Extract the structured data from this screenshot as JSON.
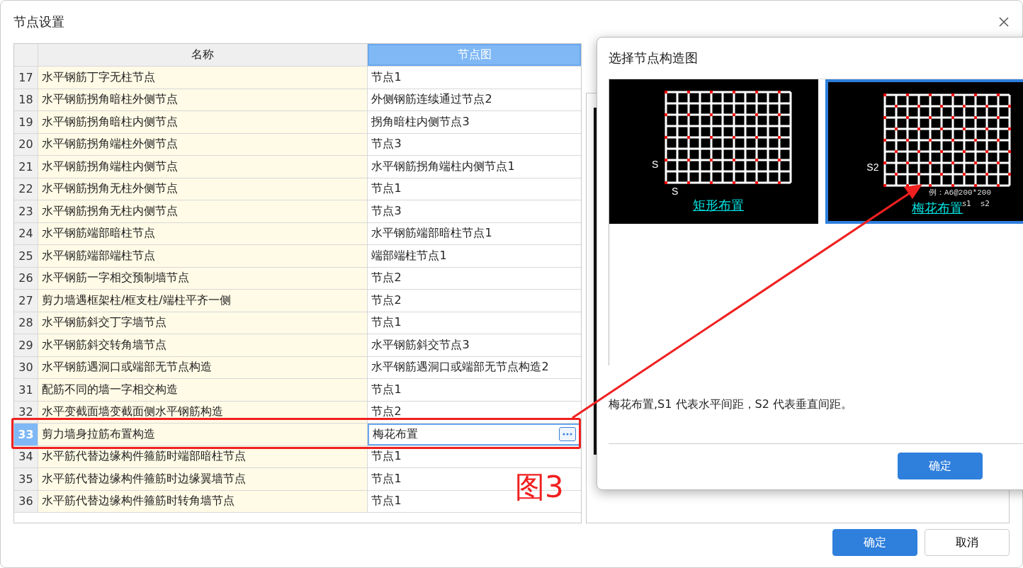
{
  "window": {
    "title": "节点设置"
  },
  "table": {
    "columns": [
      {
        "label": "名称",
        "selected": false
      },
      {
        "label": "节点图",
        "selected": true
      }
    ],
    "rows": [
      {
        "no": "17",
        "name": "水平钢筋丁字无柱节点",
        "value": "节点1",
        "selected": false
      },
      {
        "no": "18",
        "name": "水平钢筋拐角暗柱外侧节点",
        "value": "外侧钢筋连续通过节点2",
        "selected": false
      },
      {
        "no": "19",
        "name": "水平钢筋拐角暗柱内侧节点",
        "value": "拐角暗柱内侧节点3",
        "selected": false
      },
      {
        "no": "20",
        "name": "水平钢筋拐角端柱外侧节点",
        "value": "节点3",
        "selected": false
      },
      {
        "no": "21",
        "name": "水平钢筋拐角端柱内侧节点",
        "value": "水平钢筋拐角端柱内侧节点1",
        "selected": false
      },
      {
        "no": "22",
        "name": "水平钢筋拐角无柱外侧节点",
        "value": "节点1",
        "selected": false
      },
      {
        "no": "23",
        "name": "水平钢筋拐角无柱内侧节点",
        "value": "节点3",
        "selected": false
      },
      {
        "no": "24",
        "name": "水平钢筋端部暗柱节点",
        "value": "水平钢筋端部暗柱节点1",
        "selected": false
      },
      {
        "no": "25",
        "name": "水平钢筋端部端柱节点",
        "value": "端部端柱节点1",
        "selected": false
      },
      {
        "no": "26",
        "name": "水平钢筋一字相交预制墙节点",
        "value": "节点2",
        "selected": false
      },
      {
        "no": "27",
        "name": "剪力墙遇框架柱/框支柱/端柱平齐一侧",
        "value": "节点2",
        "selected": false
      },
      {
        "no": "28",
        "name": "水平钢筋斜交丁字墙节点",
        "value": "节点1",
        "selected": false
      },
      {
        "no": "29",
        "name": "水平钢筋斜交转角墙节点",
        "value": "水平钢筋斜交节点3",
        "selected": false
      },
      {
        "no": "30",
        "name": "水平钢筋遇洞口或端部无节点构造",
        "value": "水平钢筋遇洞口或端部无节点构造2",
        "selected": false
      },
      {
        "no": "31",
        "name": "配筋不同的墙一字相交构造",
        "value": "节点1",
        "selected": false
      },
      {
        "no": "32",
        "name": "水平变截面墙变截面侧水平钢筋构造",
        "value": "节点2",
        "selected": false
      },
      {
        "no": "33",
        "name": "剪力墙身拉筋布置构造",
        "value": "梅花布置",
        "selected": true
      },
      {
        "no": "34",
        "name": "水平筋代替边缘构件箍筋时端部暗柱节点",
        "value": "节点1",
        "selected": false
      },
      {
        "no": "35",
        "name": "水平筋代替边缘构件箍筋时边缘翼墙节点",
        "value": "节点1",
        "selected": false
      },
      {
        "no": "36",
        "name": "水平筋代替边缘构件箍筋时转角墙节点",
        "value": "节点1",
        "selected": false
      }
    ]
  },
  "annotation": {
    "label": "图3"
  },
  "buttons": [
    "确定",
    "取消"
  ],
  "popup": {
    "title": "选择节点构造图",
    "options": [
      {
        "kind": "rect",
        "caption": "矩形布置",
        "selected": false,
        "v_label": "S",
        "h_label": "S"
      },
      {
        "kind": "plum",
        "caption": "梅花布置",
        "selected": true,
        "v_label": "S2",
        "example": "例：A6@200*200",
        "s1": "s1",
        "s2": "s2"
      }
    ],
    "description": "梅花布置,S1 代表水平间距，S2 代表垂直间距。",
    "ok": "确定"
  }
}
